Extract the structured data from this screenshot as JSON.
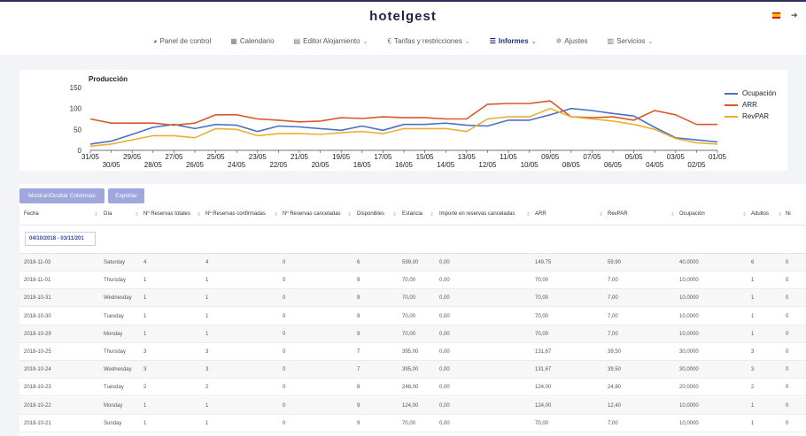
{
  "header": {
    "brand": "hotelgest",
    "nav": [
      {
        "icon": "palette-icon",
        "glyph": "◕",
        "label": "Panel de control",
        "caret": false,
        "active": false
      },
      {
        "icon": "calendar-icon",
        "glyph": "▦",
        "label": "Calendario",
        "caret": false,
        "active": false
      },
      {
        "icon": "edit-icon",
        "glyph": "▤",
        "label": "Editor Alojamiento",
        "caret": true,
        "active": false
      },
      {
        "icon": "euro-icon",
        "glyph": "€",
        "label": "Tarifas y restricciones",
        "caret": true,
        "active": false
      },
      {
        "icon": "list-icon",
        "glyph": "☰",
        "label": "Informes",
        "caret": true,
        "active": true
      },
      {
        "icon": "gear-icon",
        "glyph": "✲",
        "label": "Ajustes",
        "caret": false,
        "active": false
      },
      {
        "icon": "services-icon",
        "glyph": "▥",
        "label": "Servicios",
        "caret": true,
        "active": false
      }
    ],
    "logout_glyph": "➔"
  },
  "chart_data": {
    "type": "line",
    "title": "Producción",
    "ylim": [
      0,
      150
    ],
    "yticks": [
      0,
      50,
      100,
      150
    ],
    "grid": false,
    "legend": "right",
    "categories": [
      "31/05",
      "30/05",
      "29/05",
      "28/05",
      "27/05",
      "26/05",
      "25/05",
      "24/05",
      "23/05",
      "22/05",
      "21/05",
      "20/05",
      "19/05",
      "18/05",
      "17/05",
      "16/05",
      "15/05",
      "14/05",
      "13/05",
      "12/05",
      "11/05",
      "10/05",
      "09/05",
      "08/05",
      "07/05",
      "06/05",
      "05/05",
      "04/05",
      "03/05",
      "02/05",
      "01/05"
    ],
    "tick_labels_top": [
      "31/05",
      "29/05",
      "27/05",
      "25/05",
      "23/05",
      "21/05",
      "19/05",
      "17/05",
      "15/05",
      "13/05",
      "11/05",
      "09/05",
      "07/05",
      "05/05",
      "03/05",
      "01/05"
    ],
    "tick_labels_bottom": [
      "30/05",
      "28/05",
      "26/05",
      "24/05",
      "22/05",
      "20/05",
      "18/05",
      "16/05",
      "14/05",
      "12/05",
      "10/05",
      "08/05",
      "06/05",
      "04/05",
      "02/05"
    ],
    "series": [
      {
        "name": "Ocupación",
        "color": "#4a72c4",
        "values": [
          15,
          22,
          38,
          55,
          62,
          52,
          62,
          60,
          45,
          58,
          56,
          52,
          48,
          58,
          48,
          62,
          62,
          65,
          60,
          58,
          72,
          72,
          85,
          100,
          95,
          88,
          82,
          55,
          30,
          25,
          20
        ]
      },
      {
        "name": "ARR",
        "color": "#d9582b",
        "values": [
          75,
          65,
          65,
          65,
          60,
          65,
          85,
          85,
          75,
          72,
          68,
          70,
          78,
          76,
          80,
          78,
          78,
          75,
          75,
          110,
          112,
          112,
          118,
          80,
          78,
          80,
          72,
          95,
          85,
          62,
          62
        ]
      },
      {
        "name": "RevPAR",
        "color": "#eab035",
        "values": [
          10,
          15,
          25,
          35,
          35,
          30,
          52,
          50,
          35,
          40,
          40,
          38,
          42,
          45,
          40,
          52,
          52,
          52,
          45,
          75,
          80,
          80,
          100,
          80,
          75,
          70,
          62,
          50,
          28,
          18,
          15
        ]
      }
    ]
  },
  "table": {
    "buttons": {
      "columns": "Mostrar/Ocultar Columnas",
      "export": "Exportar"
    },
    "columns": [
      "Fecha",
      "Día",
      "Nº Reservas totales",
      "Nº Reservas confirmadas",
      "Nº Reservas canceladas",
      "Disponibles",
      "Estancia",
      "Importe en reservas canceladas",
      "ARR",
      "RevPAR",
      "Ocupación",
      "Adultos",
      "Ni"
    ],
    "date_filter": "04/10/2018 - 03/11/201",
    "rows": [
      [
        "2018-11-03",
        "Saturday",
        "4",
        "4",
        "0",
        "6",
        "599,00",
        "0,00",
        "149,75",
        "59,90",
        "40,0000",
        "6",
        "0"
      ],
      [
        "2018-11-01",
        "Thursday",
        "1",
        "1",
        "0",
        "9",
        "70,00",
        "0,00",
        "70,00",
        "7,00",
        "10,0000",
        "1",
        "0"
      ],
      [
        "2018-10-31",
        "Wednesday",
        "1",
        "1",
        "0",
        "9",
        "70,00",
        "0,00",
        "70,00",
        "7,00",
        "10,0000",
        "1",
        "0"
      ],
      [
        "2018-10-30",
        "Tuesday",
        "1",
        "1",
        "0",
        "9",
        "70,00",
        "0,00",
        "70,00",
        "7,00",
        "10,0000",
        "1",
        "0"
      ],
      [
        "2018-10-29",
        "Monday",
        "1",
        "1",
        "0",
        "9",
        "70,00",
        "0,00",
        "70,00",
        "7,00",
        "10,0000",
        "1",
        "0"
      ],
      [
        "2018-10-25",
        "Thursday",
        "3",
        "3",
        "0",
        "7",
        "395,00",
        "0,00",
        "131,67",
        "39,50",
        "30,0000",
        "3",
        "0"
      ],
      [
        "2018-10-24",
        "Wednesday",
        "3",
        "3",
        "0",
        "7",
        "395,00",
        "0,00",
        "131,67",
        "39,50",
        "30,0000",
        "3",
        "0"
      ],
      [
        "2018-10-23",
        "Tuesday",
        "2",
        "2",
        "0",
        "8",
        "248,00",
        "0,00",
        "124,00",
        "24,80",
        "20,0000",
        "2",
        "0"
      ],
      [
        "2018-10-22",
        "Monday",
        "1",
        "1",
        "0",
        "9",
        "124,00",
        "0,00",
        "124,00",
        "12,40",
        "10,0000",
        "1",
        "0"
      ],
      [
        "2018-10-21",
        "Sunday",
        "1",
        "1",
        "0",
        "9",
        "70,00",
        "0,00",
        "70,00",
        "7,00",
        "10,0000",
        "1",
        "0"
      ]
    ]
  }
}
